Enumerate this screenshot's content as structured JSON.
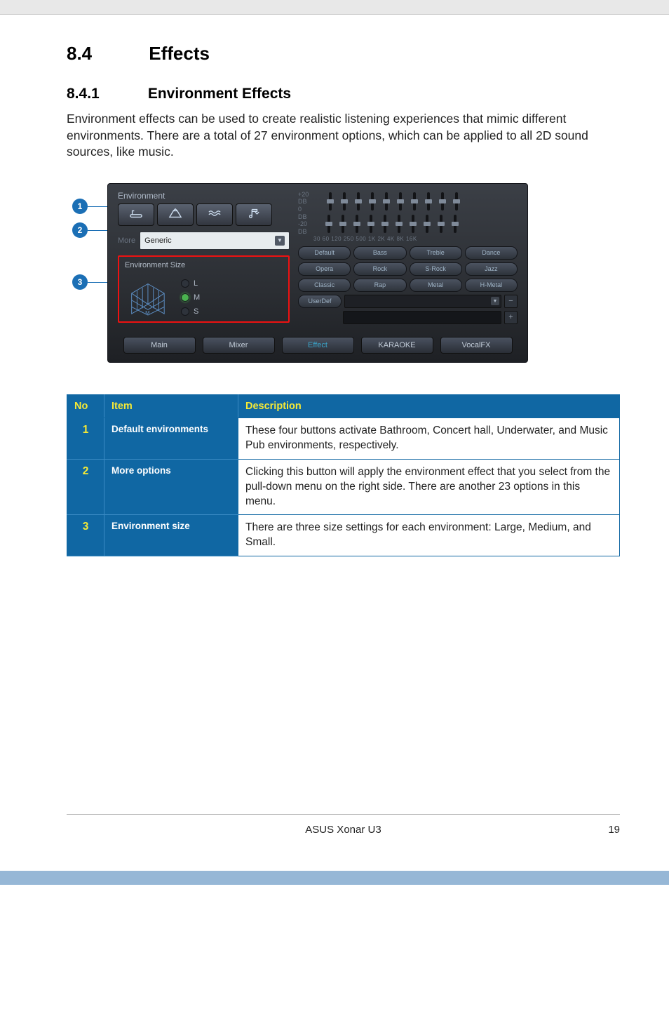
{
  "page": {
    "section_num": "8.4",
    "section_title": "Effects",
    "subsection_num": "8.4.1",
    "subsection_title": "Environment Effects",
    "body": "Environment effects can be used to create realistic listening experiences that mimic different environments. There are a total of 27 environment options, which can be applied to all 2D sound sources, like music.",
    "footer_product": "ASUS Xonar U3",
    "page_number": "19"
  },
  "callouts": [
    "1",
    "2",
    "3"
  ],
  "screenshot": {
    "panel_title": "Environment",
    "more_label": "More",
    "more_selected": "Generic",
    "env_size_title": "Environment Size",
    "size_options": {
      "L": "L",
      "M": "M",
      "S": "S"
    },
    "size_scale_letter": "M",
    "eq_scale_top": "+20",
    "eq_scale_db": "DB",
    "eq_scale_zero": "0",
    "eq_scale_neg": "-20",
    "freq_labels": "30   60   120  250  500   1K    2K    4K   8K  16K",
    "presets": [
      "Default",
      "Bass",
      "Treble",
      "Dance",
      "Opera",
      "Rock",
      "S-Rock",
      "Jazz",
      "Classic",
      "Rap",
      "Metal",
      "H-Metal"
    ],
    "userdef_label": "UserDef",
    "tabs": [
      "Main",
      "Mixer",
      "Effect",
      "KARAOKE",
      "VocalFX"
    ]
  },
  "table": {
    "header_no": "No",
    "header_item": "Item",
    "header_desc": "Description",
    "rows": [
      {
        "no": "1",
        "item": "Default environments",
        "desc": "These four buttons activate Bathroom, Concert hall, Underwater, and Music Pub environments, respectively."
      },
      {
        "no": "2",
        "item": "More options",
        "desc": "Clicking this button will apply the environment effect that you select from the pull-down menu on the right side. There are another 23 options in this menu."
      },
      {
        "no": "3",
        "item": "Environment size",
        "desc": "There are three size settings for each environment: Large, Medium, and Small."
      }
    ]
  }
}
